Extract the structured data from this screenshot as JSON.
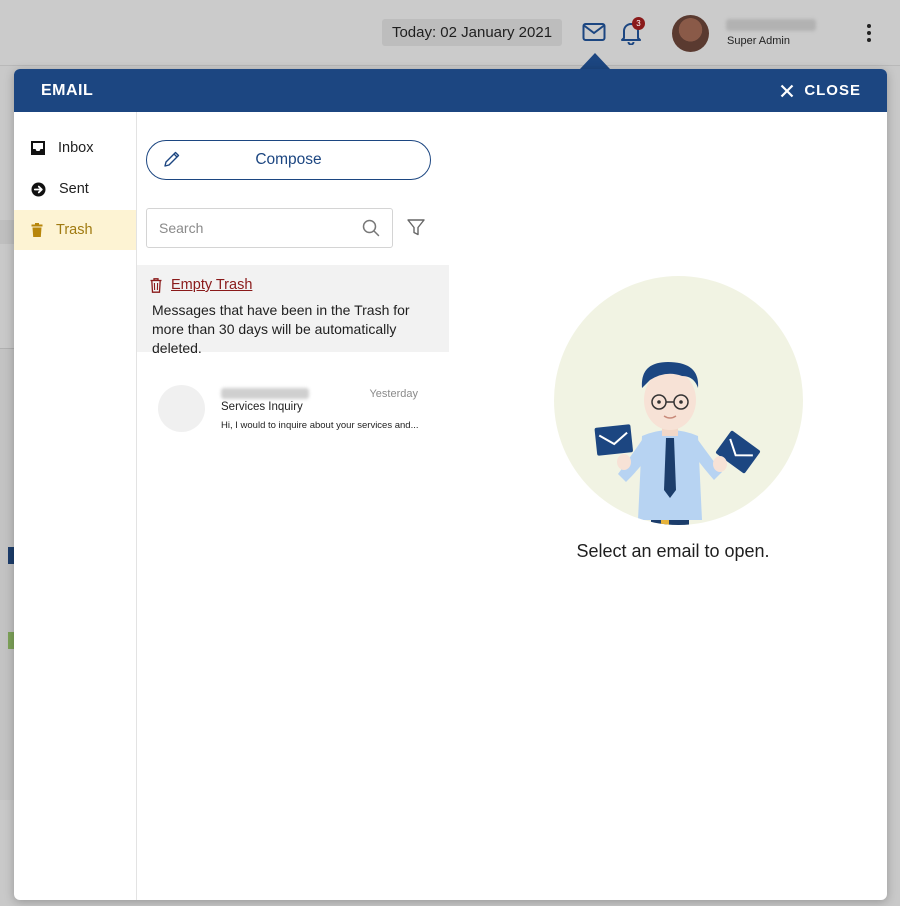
{
  "header": {
    "date": "Today: 02 January 2021",
    "notification_count": "3",
    "user_role": "Super Admin"
  },
  "dialog": {
    "title": "EMAIL",
    "close_label": "CLOSE"
  },
  "nav": {
    "items": [
      {
        "label": "Inbox",
        "icon": "inbox-icon"
      },
      {
        "label": "Sent",
        "icon": "sent-icon"
      },
      {
        "label": "Trash",
        "icon": "trash-icon",
        "active": true
      }
    ]
  },
  "list": {
    "compose_label": "Compose",
    "search_placeholder": "Search",
    "empty_trash_label": "Empty Trash",
    "trash_note": "Messages that have been in the Trash for more than 30 days will be automatically deleted.",
    "messages": [
      {
        "date": "Yesterday",
        "subject": "Services Inquiry",
        "snippet": "Hi, I would to inquire about your services and..."
      }
    ]
  },
  "preview": {
    "empty_message": "Select an email to open."
  },
  "colors": {
    "primary": "#1c4681",
    "trash_active_bg": "#fdf3d3",
    "trash_active_text": "#a07a10",
    "danger": "#8a1a1a"
  }
}
